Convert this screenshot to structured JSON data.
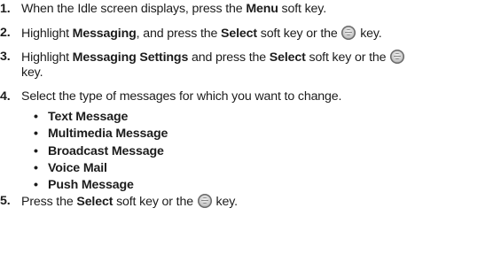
{
  "steps": [
    {
      "number": "1.",
      "parts": [
        "When the Idle screen displays, press the ",
        "Menu",
        " soft key."
      ]
    },
    {
      "number": "2.",
      "parts": [
        "Highlight ",
        "Messaging",
        ", and press the ",
        "Select",
        " soft key or the ",
        " key."
      ]
    },
    {
      "number": "3.",
      "parts": [
        "Highlight ",
        "Messaging Settings",
        " and press the ",
        "Select",
        " soft key or the ",
        "key."
      ]
    },
    {
      "number": "4.",
      "parts": [
        "Select the type of messages for which you want to change."
      ]
    },
    {
      "number": "5.",
      "parts": [
        "Press the ",
        "Select",
        " soft key or the ",
        " key."
      ]
    }
  ],
  "bullets": [
    "Text Message",
    "Multimedia Message",
    "Broadcast Message",
    "Voice Mail",
    "Push Message"
  ],
  "bullet_char": "•",
  "icon": "ok-key-icon"
}
